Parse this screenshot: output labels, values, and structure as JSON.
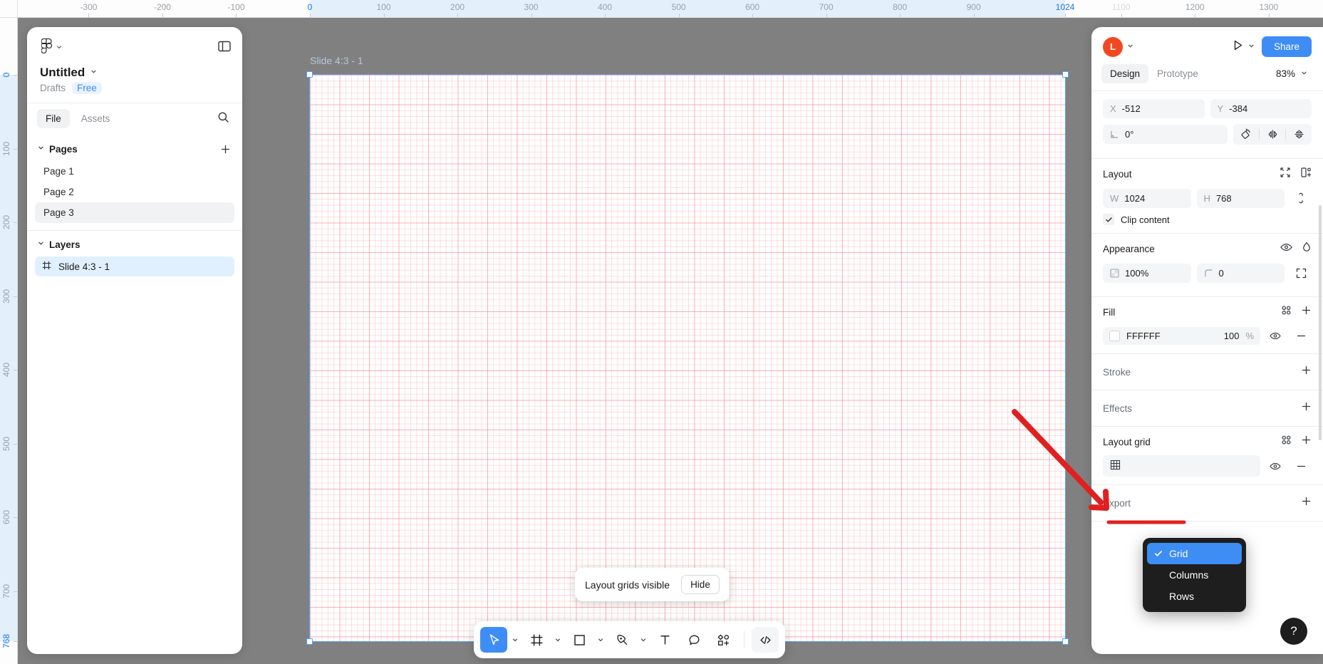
{
  "rulers": {
    "top_ticks": [
      {
        "label": "-300",
        "pos": -300
      },
      {
        "label": "-200",
        "pos": -200
      },
      {
        "label": "-100",
        "pos": -100
      },
      {
        "label": "0",
        "pos": 0,
        "state": "active"
      },
      {
        "label": "100",
        "pos": 100
      },
      {
        "label": "200",
        "pos": 200
      },
      {
        "label": "300",
        "pos": 300
      },
      {
        "label": "400",
        "pos": 400
      },
      {
        "label": "500",
        "pos": 500
      },
      {
        "label": "600",
        "pos": 600
      },
      {
        "label": "700",
        "pos": 700
      },
      {
        "label": "800",
        "pos": 800
      },
      {
        "label": "900",
        "pos": 900
      },
      {
        "label": "1024",
        "pos": 1024,
        "state": "active"
      },
      {
        "label": "1100",
        "pos": 1100,
        "state": "faded"
      },
      {
        "label": "1200",
        "pos": 1200
      },
      {
        "label": "1300",
        "pos": 1300
      }
    ],
    "left_ticks": [
      {
        "label": "0",
        "pos": 0,
        "state": "active"
      },
      {
        "label": "100",
        "pos": 100
      },
      {
        "label": "200",
        "pos": 200
      },
      {
        "label": "300",
        "pos": 300
      },
      {
        "label": "400",
        "pos": 400
      },
      {
        "label": "500",
        "pos": 500
      },
      {
        "label": "600",
        "pos": 600
      },
      {
        "label": "700",
        "pos": 700
      },
      {
        "label": "768",
        "pos": 768,
        "state": "active"
      }
    ]
  },
  "left_panel": {
    "logo_icon": "figma-logo-icon",
    "menu_caret_icon": "chevron-down-icon",
    "panel_toggle_icon": "panel-layout-icon",
    "file_title": "Untitled",
    "title_caret_icon": "chevron-down-icon",
    "drafts_label": "Drafts",
    "plan_badge": "Free",
    "tabs": [
      {
        "label": "File",
        "active": true
      },
      {
        "label": "Assets",
        "active": false
      }
    ],
    "search_icon": "search-icon",
    "pages_section": {
      "title": "Pages",
      "collapse_icon": "chevron-down-icon",
      "add_icon": "plus-icon",
      "items": [
        {
          "label": "Page 1",
          "selected": false
        },
        {
          "label": "Page 2",
          "selected": false
        },
        {
          "label": "Page 3",
          "selected": true
        }
      ]
    },
    "layers_section": {
      "title": "Layers",
      "collapse_icon": "chevron-down-icon",
      "items": [
        {
          "label": "Slide 4:3 - 1",
          "icon": "frame-icon",
          "selected": true
        }
      ]
    }
  },
  "canvas": {
    "frame_label": "Slide 4:3 - 1",
    "grid_color": "#F48C91",
    "frame_fill": "#FFFFFF",
    "selection_color": "#4AA3FF"
  },
  "right_panel": {
    "avatar_initial": "L",
    "avatar_color": "#F24822",
    "avatar_caret_icon": "chevron-down-icon",
    "present_icon": "play-icon",
    "present_caret_icon": "chevron-down-icon",
    "share_label": "Share",
    "share_color": "#3D8DF5",
    "tabs": [
      {
        "label": "Design",
        "active": true
      },
      {
        "label": "Prototype",
        "active": false
      }
    ],
    "zoom_level": "83%",
    "zoom_caret_icon": "chevron-down-icon",
    "position": {
      "x_label": "X",
      "x_value": "-512",
      "y_label": "Y",
      "y_value": "-384",
      "rotation_label": "rotation-icon",
      "rotation_value": "0°",
      "flip_rotate_icon": "rotate-icon",
      "flip_horizontal_icon": "flip-horizontal-icon",
      "flip_vertical_icon": "flip-vertical-icon"
    },
    "layout": {
      "title": "Layout",
      "resize_icon": "resize-to-fit-icon",
      "add_auto_layout_icon": "add-layout-icon",
      "w_label": "W",
      "w_value": "1024",
      "h_label": "H",
      "h_value": "768",
      "aspect_ratio_icon": "aspect-ratio-lock-icon",
      "clip_content_label": "Clip content",
      "clip_content_checked": true
    },
    "appearance": {
      "title": "Appearance",
      "visibility_icon": "eye-icon",
      "blend_icon": "blend-mode-icon",
      "opacity_icon": "opacity-icon",
      "opacity_value": "100%",
      "corner_icon": "corner-radius-icon",
      "corner_value": "0",
      "individual_corners_icon": "individual-corners-icon"
    },
    "fill": {
      "title": "Fill",
      "styles_icon": "styles-icon",
      "add_icon": "plus-icon",
      "swatch_color": "#FFFFFF",
      "hex_value": "FFFFFF",
      "opacity_value": "100",
      "opacity_unit": "%",
      "visibility_icon": "eye-icon",
      "remove_icon": "minus-icon"
    },
    "stroke": {
      "title": "Stroke",
      "add_icon": "plus-icon"
    },
    "effects": {
      "title": "Effects",
      "add_icon": "plus-icon"
    },
    "layout_grid": {
      "title": "Layout grid",
      "styles_icon": "styles-icon",
      "add_icon": "plus-icon",
      "grid_type_icon": "grid-icon",
      "visibility_icon": "eye-icon",
      "remove_icon": "minus-icon"
    },
    "export": {
      "title": "Export",
      "add_icon": "plus-icon"
    }
  },
  "dropdown": {
    "options": [
      {
        "label": "Grid",
        "selected": true,
        "check_icon": "check-icon"
      },
      {
        "label": "Columns",
        "selected": false
      },
      {
        "label": "Rows",
        "selected": false
      }
    ],
    "highlight_color": "#3D8DF5",
    "background_color": "#1E1E1E"
  },
  "toast": {
    "message": "Layout grids visible",
    "button_label": "Hide"
  },
  "toolbar": {
    "items": [
      {
        "name": "move-tool",
        "icon": "cursor-icon",
        "active": true,
        "caret": true
      },
      {
        "name": "frame-tool",
        "icon": "frame-icon",
        "active": false,
        "caret": true
      },
      {
        "name": "shape-tool",
        "icon": "square-icon",
        "active": false,
        "caret": true
      },
      {
        "name": "pen-tool",
        "icon": "pen-icon",
        "active": false,
        "caret": true
      },
      {
        "name": "text-tool",
        "icon": "text-icon",
        "active": false,
        "caret": false
      },
      {
        "name": "comment-tool",
        "icon": "comment-icon",
        "active": false,
        "caret": false
      },
      {
        "name": "actions-tool",
        "icon": "plugins-icon",
        "active": false,
        "caret": false
      }
    ],
    "dev_mode_icon": "code-icon"
  },
  "help": {
    "label": "?",
    "icon": "help-icon"
  },
  "annotation": {
    "arrow_color": "#E02020",
    "underline_color": "#E02020",
    "target": "Layout grid"
  }
}
